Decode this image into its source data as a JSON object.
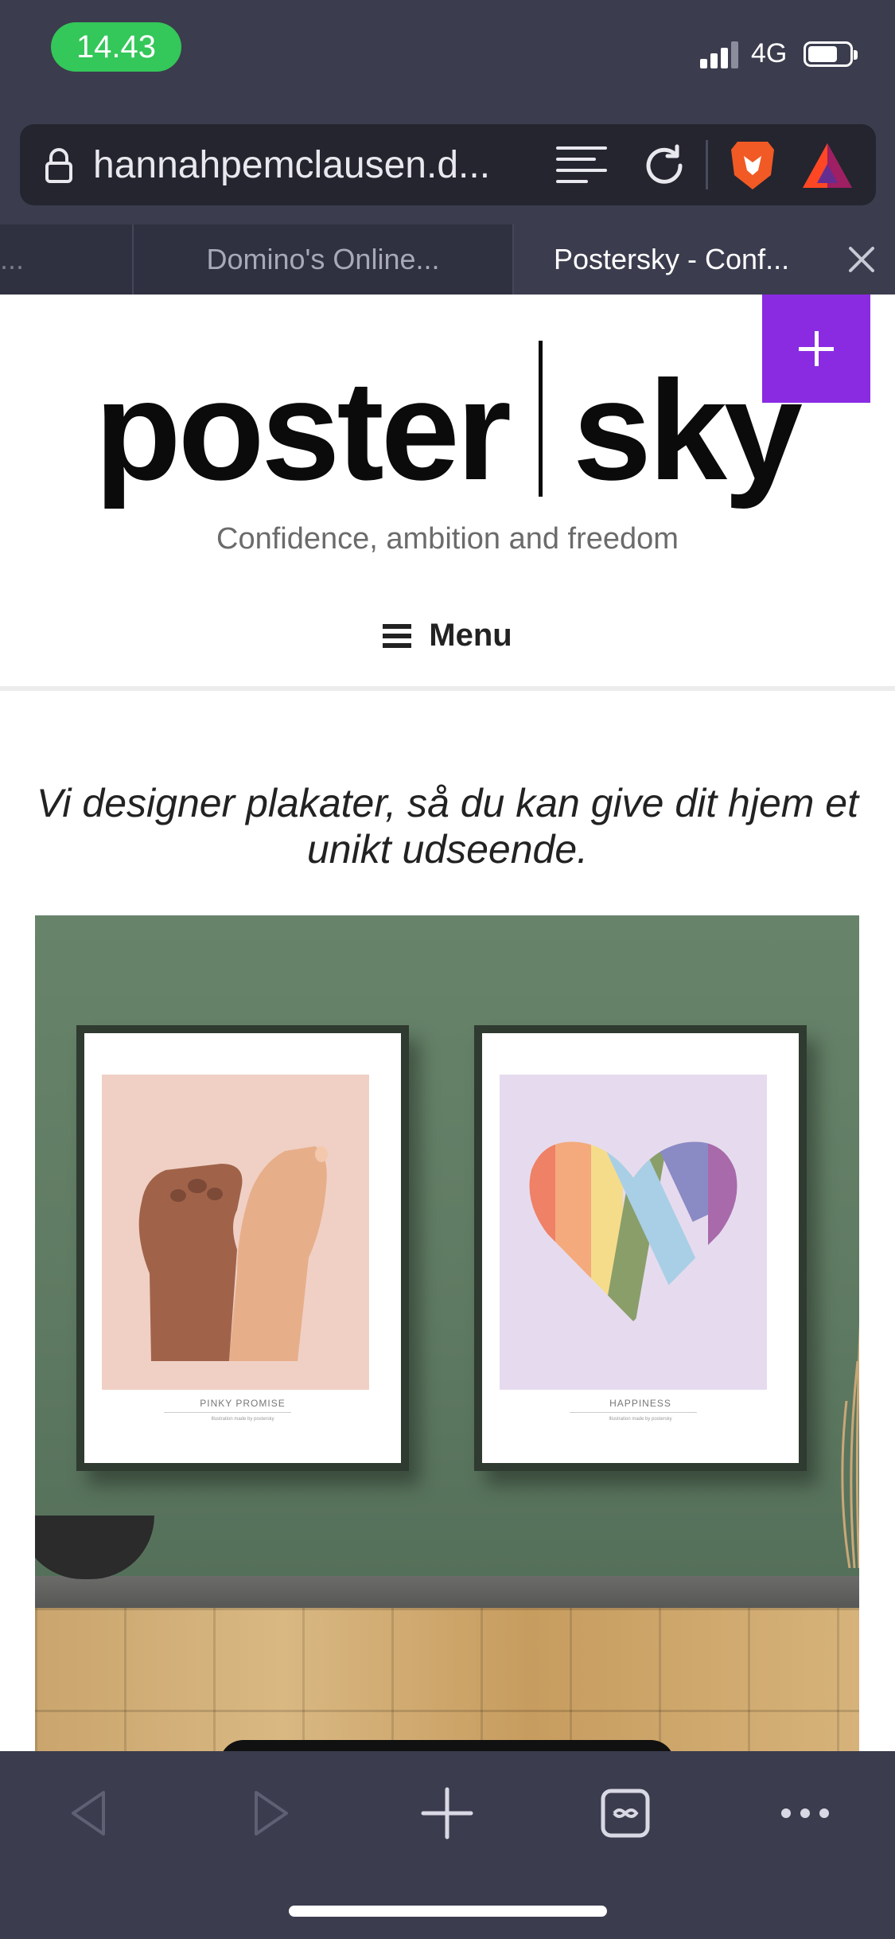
{
  "status": {
    "time": "14.43",
    "network": "4G"
  },
  "browser": {
    "url": "hannahpemclausen.d...",
    "tabs": [
      {
        "label": "e..."
      },
      {
        "label": "Domino's Online..."
      },
      {
        "label": "Postersky - Conf..."
      }
    ]
  },
  "site": {
    "logo_left": "poster",
    "logo_right": "sky",
    "tagline": "Confidence, ambition and freedom",
    "menu_label": "Menu",
    "headline": "Vi designer plakater, så du kan give dit hjem et unikt udseende."
  },
  "hero": {
    "posters": [
      {
        "title": "PINKY PROMISE",
        "subtitle": "Illustration made by postersky"
      },
      {
        "title": "HAPPINESS",
        "subtitle": "Illustration made by postersky"
      }
    ]
  },
  "colors": {
    "accent": "#8a2be2",
    "status_green": "#34c759",
    "chrome": "#3b3c4e"
  },
  "icons": [
    "lock-icon",
    "reader-mode-icon",
    "reload-icon",
    "brave-shield-icon",
    "bat-rewards-icon",
    "close-tab-icon",
    "back-icon",
    "forward-icon",
    "new-tab-icon",
    "tabs-icon",
    "more-icon"
  ]
}
